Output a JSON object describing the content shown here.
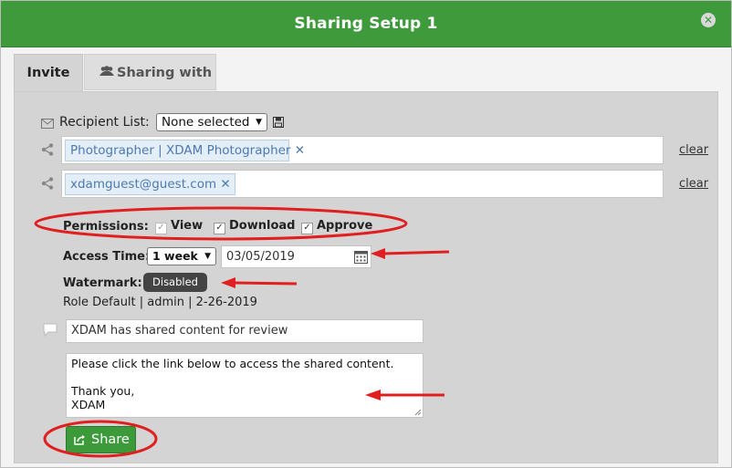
{
  "dialog": {
    "title": "Sharing Setup 1"
  },
  "tabs": [
    {
      "label": "Invite"
    },
    {
      "label": "Sharing with"
    }
  ],
  "recipient_list": {
    "label": "Recipient List:",
    "selected": "None selected"
  },
  "recipients": [
    {
      "token": "Photographer | XDAM Photographer",
      "clear_label": "clear"
    },
    {
      "token": "xdamguest@guest.com",
      "clear_label": "clear"
    }
  ],
  "permissions": {
    "label": "Permissions:",
    "options": [
      {
        "label": "View",
        "checked": true
      },
      {
        "label": "Download",
        "checked": true
      },
      {
        "label": "Approve",
        "checked": true
      }
    ]
  },
  "access_time": {
    "label": "Access Time:",
    "duration": "1 week",
    "date": "03/05/2019"
  },
  "watermark": {
    "label": "Watermark:",
    "status": "Disabled"
  },
  "role_info": "Role Default | admin | 2-26-2019",
  "message": {
    "subject": "XDAM has shared content for review",
    "body_line1": "Please click the link below to access the shared content.",
    "body_line2": "Thank you,",
    "body_line3": "XDAM"
  },
  "share_button": {
    "label": "Share"
  },
  "colors": {
    "header_green": "#3f9a3c",
    "annotation_red": "#e02020",
    "token_blue": "#4d79b1"
  }
}
